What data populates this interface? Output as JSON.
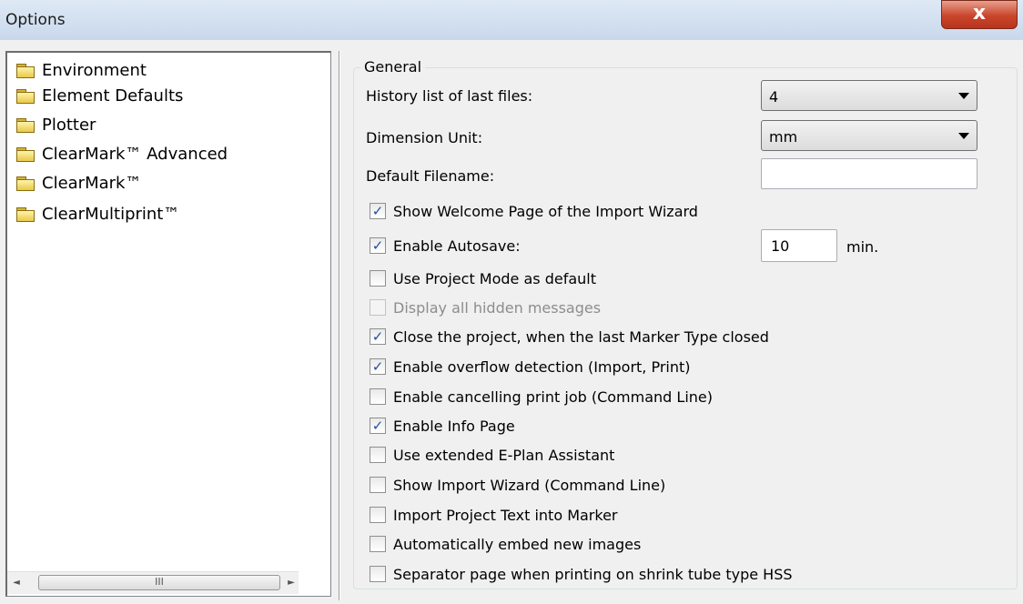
{
  "window": {
    "title": "Options",
    "close_glyph": "x"
  },
  "tree": {
    "items": [
      {
        "label": "Environment",
        "icon": "folder-icon"
      },
      {
        "label": "Element Defaults",
        "icon": "folder-icon"
      },
      {
        "label": "Plotter",
        "icon": "folder-icon"
      },
      {
        "label": "ClearMark™ Advanced",
        "icon": "folder-icon"
      },
      {
        "label": "ClearMark™",
        "icon": "folder-icon"
      },
      {
        "label": "ClearMultiprint™",
        "icon": "folder-icon"
      }
    ],
    "scroll": {
      "left_arrow": "◄",
      "right_arrow": "►",
      "thumb_grip": "III"
    }
  },
  "general": {
    "legend": "General",
    "history_label": "History list of last files:",
    "history_value": "4",
    "unit_label": "Dimension Unit:",
    "unit_value": "mm",
    "filename_label": "Default Filename:",
    "filename_value": "",
    "autosave_value": "10",
    "autosave_unit": "min.",
    "checkboxes": [
      {
        "label": "Show Welcome Page of the Import Wizard",
        "checked": true,
        "enabled": true
      },
      {
        "label": "Enable Autosave:",
        "checked": true,
        "enabled": true
      },
      {
        "label": "Use Project Mode as default",
        "checked": false,
        "enabled": true
      },
      {
        "label": "Display all hidden messages",
        "checked": false,
        "enabled": false
      },
      {
        "label": "Close the project, when the last Marker Type closed",
        "checked": true,
        "enabled": true
      },
      {
        "label": "Enable overflow detection (Import, Print)",
        "checked": true,
        "enabled": true
      },
      {
        "label": "Enable cancelling print job (Command Line)",
        "checked": false,
        "enabled": true
      },
      {
        "label": "Enable Info Page",
        "checked": true,
        "enabled": true
      },
      {
        "label": "Use extended E-Plan Assistant",
        "checked": false,
        "enabled": true
      },
      {
        "label": " Show Import Wizard  (Command Line)",
        "checked": false,
        "enabled": true
      },
      {
        "label": "Import Project Text into Marker",
        "checked": false,
        "enabled": true
      },
      {
        "label": "Automatically embed new images",
        "checked": false,
        "enabled": true
      },
      {
        "label": "Separator page when printing on shrink tube type HSS",
        "checked": false,
        "enabled": true
      }
    ],
    "check_glyph": "✓"
  },
  "colors": {
    "accent": "#1f4f9a",
    "close": "#c9452b"
  }
}
